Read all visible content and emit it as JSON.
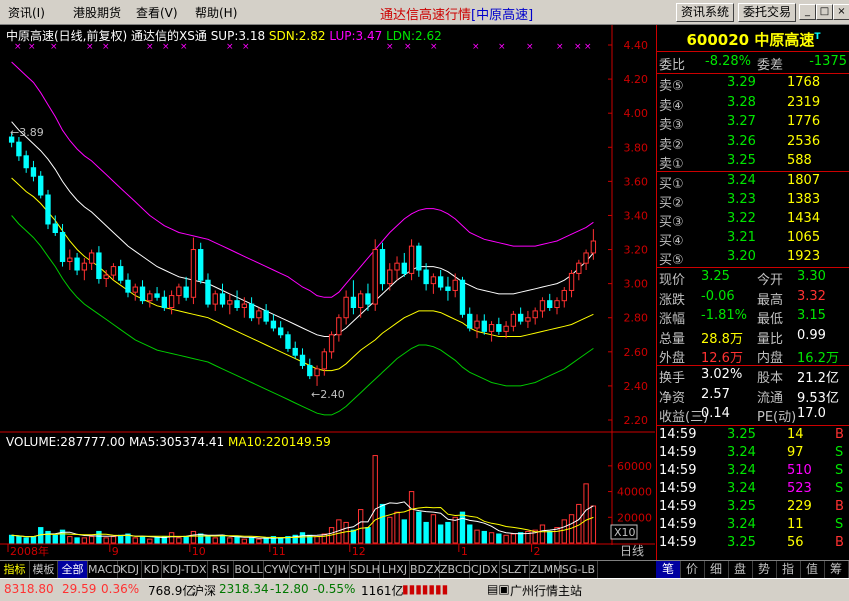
{
  "menu": {
    "items": [
      "资讯(I)",
      "港股期货",
      "查看(V)",
      "帮助(H)"
    ]
  },
  "app": {
    "title": "通达信高速行情",
    "subtitle": "[中原高速]"
  },
  "sys_buttons": {
    "info": "资讯系统",
    "trade": "委托交易"
  },
  "chart": {
    "header": {
      "stock": "中原高速(日线,前复权)",
      "indicator": "通达信的XS通",
      "sup": "SUP:3.18",
      "sdn": "SDN:2.82",
      "lup": "LUP:3.47",
      "ldn": "LDN:2.62"
    },
    "price_axis": [
      "4.40",
      "4.20",
      "4.00",
      "3.80",
      "3.60",
      "3.40",
      "3.20",
      "3.00",
      "2.80",
      "2.60",
      "2.40",
      "2.20"
    ],
    "high_mark": "3.89",
    "low_mark": "2.40",
    "volume_header": {
      "volume": "VOLUME:287777.00",
      "ma5": "MA5:305374.41",
      "ma10": "MA10:220149.59"
    },
    "volume_axis": [
      "60000",
      "40000",
      "20000"
    ],
    "volume_unit": "X10",
    "date_axis": [
      "2008年",
      "9",
      "10",
      "11",
      "12",
      "1",
      "2"
    ],
    "period": "日线"
  },
  "chart_data": {
    "type": "candlestick",
    "price_range": [
      2.2,
      4.4
    ],
    "volume_range": [
      0,
      70000
    ],
    "grid": false,
    "candles": [
      [
        3.86,
        3.89,
        3.8,
        3.83
      ],
      [
        3.83,
        3.86,
        3.72,
        3.75
      ],
      [
        3.75,
        3.78,
        3.65,
        3.68
      ],
      [
        3.68,
        3.72,
        3.6,
        3.63
      ],
      [
        3.63,
        3.66,
        3.5,
        3.52
      ],
      [
        3.52,
        3.55,
        3.32,
        3.35
      ],
      [
        3.35,
        3.4,
        3.28,
        3.3
      ],
      [
        3.3,
        3.35,
        3.1,
        3.13
      ],
      [
        3.13,
        3.2,
        3.08,
        3.15
      ],
      [
        3.15,
        3.18,
        3.05,
        3.08
      ],
      [
        3.08,
        3.15,
        3.02,
        3.12
      ],
      [
        3.12,
        3.2,
        3.08,
        3.18
      ],
      [
        3.18,
        3.22,
        3.0,
        3.03
      ],
      [
        3.03,
        3.08,
        2.98,
        3.05
      ],
      [
        3.05,
        3.12,
        3.02,
        3.1
      ],
      [
        3.1,
        3.14,
        3.0,
        3.02
      ],
      [
        3.02,
        3.06,
        2.92,
        2.95
      ],
      [
        2.95,
        3.0,
        2.9,
        2.98
      ],
      [
        2.98,
        3.02,
        2.88,
        2.9
      ],
      [
        2.9,
        2.96,
        2.86,
        2.94
      ],
      [
        2.94,
        2.98,
        2.9,
        2.92
      ],
      [
        2.92,
        2.96,
        2.84,
        2.86
      ],
      [
        2.86,
        2.96,
        2.82,
        2.93
      ],
      [
        2.93,
        3.0,
        2.88,
        2.98
      ],
      [
        2.98,
        3.04,
        2.9,
        2.92
      ],
      [
        2.92,
        3.27,
        2.88,
        3.2
      ],
      [
        3.2,
        3.24,
        3.0,
        3.02
      ],
      [
        3.02,
        3.06,
        2.86,
        2.88
      ],
      [
        2.88,
        2.96,
        2.84,
        2.94
      ],
      [
        2.94,
        3.0,
        2.86,
        2.88
      ],
      [
        2.88,
        2.94,
        2.82,
        2.9
      ],
      [
        2.9,
        2.96,
        2.84,
        2.86
      ],
      [
        2.86,
        2.92,
        2.8,
        2.88
      ],
      [
        2.88,
        2.92,
        2.78,
        2.8
      ],
      [
        2.8,
        2.86,
        2.76,
        2.84
      ],
      [
        2.84,
        2.88,
        2.76,
        2.78
      ],
      [
        2.78,
        2.82,
        2.72,
        2.74
      ],
      [
        2.74,
        2.78,
        2.68,
        2.7
      ],
      [
        2.7,
        2.72,
        2.6,
        2.62
      ],
      [
        2.62,
        2.66,
        2.56,
        2.58
      ],
      [
        2.58,
        2.62,
        2.5,
        2.52
      ],
      [
        2.52,
        2.56,
        2.44,
        2.46
      ],
      [
        2.46,
        2.52,
        2.4,
        2.5
      ],
      [
        2.5,
        2.62,
        2.46,
        2.6
      ],
      [
        2.6,
        2.72,
        2.56,
        2.7
      ],
      [
        2.7,
        2.82,
        2.66,
        2.8
      ],
      [
        2.8,
        2.96,
        2.76,
        2.92
      ],
      [
        2.92,
        3.02,
        2.82,
        2.86
      ],
      [
        2.86,
        2.96,
        2.8,
        2.94
      ],
      [
        2.94,
        3.0,
        2.84,
        2.88
      ],
      [
        2.88,
        3.26,
        2.84,
        3.2
      ],
      [
        3.2,
        3.24,
        2.96,
        3.0
      ],
      [
        3.0,
        3.12,
        2.96,
        3.08
      ],
      [
        3.08,
        3.16,
        3.02,
        3.12
      ],
      [
        3.12,
        3.18,
        3.04,
        3.06
      ],
      [
        3.06,
        3.26,
        3.02,
        3.22
      ],
      [
        3.22,
        3.24,
        3.04,
        3.08
      ],
      [
        3.08,
        3.12,
        2.96,
        3.0
      ],
      [
        3.0,
        3.06,
        2.94,
        3.04
      ],
      [
        3.04,
        3.08,
        2.96,
        2.98
      ],
      [
        2.98,
        3.04,
        2.9,
        2.96
      ],
      [
        2.96,
        3.06,
        2.92,
        3.02
      ],
      [
        3.02,
        3.04,
        2.8,
        2.82
      ],
      [
        2.82,
        2.86,
        2.72,
        2.74
      ],
      [
        2.74,
        2.82,
        2.68,
        2.78
      ],
      [
        2.78,
        2.82,
        2.7,
        2.72
      ],
      [
        2.72,
        2.78,
        2.66,
        2.76
      ],
      [
        2.76,
        2.8,
        2.7,
        2.72
      ],
      [
        2.72,
        2.78,
        2.68,
        2.75
      ],
      [
        2.75,
        2.84,
        2.72,
        2.82
      ],
      [
        2.82,
        2.86,
        2.76,
        2.78
      ],
      [
        2.78,
        2.84,
        2.74,
        2.8
      ],
      [
        2.8,
        2.86,
        2.76,
        2.84
      ],
      [
        2.84,
        2.92,
        2.8,
        2.9
      ],
      [
        2.9,
        2.94,
        2.84,
        2.86
      ],
      [
        2.86,
        2.92,
        2.82,
        2.9
      ],
      [
        2.9,
        2.98,
        2.86,
        2.96
      ],
      [
        2.96,
        3.08,
        2.92,
        3.06
      ],
      [
        3.06,
        3.14,
        3.02,
        3.12
      ],
      [
        3.12,
        3.2,
        3.08,
        3.18
      ],
      [
        3.18,
        3.32,
        3.14,
        3.25
      ]
    ],
    "volumes": [
      6000,
      5000,
      4000,
      5000,
      12000,
      9000,
      6000,
      10000,
      5000,
      4000,
      4000,
      5000,
      9000,
      4000,
      5000,
      6000,
      7000,
      4000,
      5000,
      3000,
      4000,
      5000,
      8000,
      4000,
      5000,
      9000,
      7000,
      5000,
      4000,
      6000,
      4000,
      5000,
      3000,
      4000,
      3000,
      4000,
      5000,
      4000,
      5000,
      6000,
      8000,
      6000,
      5000,
      7000,
      12000,
      18000,
      16000,
      10000,
      26000,
      12000,
      68000,
      30000,
      20000,
      24000,
      18000,
      40000,
      24000,
      16000,
      22000,
      14000,
      16000,
      20000,
      24000,
      14000,
      10000,
      9000,
      8000,
      7000,
      6000,
      7000,
      8000,
      9000,
      10000,
      14000,
      9000,
      12000,
      18000,
      22000,
      30000,
      46000,
      28778
    ],
    "lup": [
      4.3,
      4.26,
      4.22,
      4.18,
      4.12,
      4.05,
      3.98,
      3.9,
      3.84,
      3.79,
      3.75,
      3.72,
      3.68,
      3.64,
      3.6,
      3.56,
      3.52,
      3.48,
      3.44,
      3.4,
      3.37,
      3.34,
      3.32,
      3.3,
      3.29,
      3.28,
      3.27,
      3.26,
      3.24,
      3.22,
      3.2,
      3.18,
      3.16,
      3.14,
      3.12,
      3.1,
      3.08,
      3.06,
      3.04,
      3.01,
      2.98,
      2.96,
      2.93,
      2.92,
      2.92,
      2.95,
      3.0,
      3.05,
      3.1,
      3.15,
      3.2,
      3.25,
      3.3,
      3.34,
      3.38,
      3.41,
      3.43,
      3.44,
      3.44,
      3.43,
      3.41,
      3.38,
      3.34,
      3.3,
      3.28,
      3.26,
      3.25,
      3.24,
      3.23,
      3.22,
      3.22,
      3.22,
      3.22,
      3.23,
      3.24,
      3.25,
      3.27,
      3.29,
      3.31,
      3.33,
      3.36
    ],
    "sup": [
      3.95,
      3.9,
      3.86,
      3.82,
      3.78,
      3.73,
      3.67,
      3.6,
      3.54,
      3.49,
      3.45,
      3.42,
      3.38,
      3.34,
      3.3,
      3.26,
      3.22,
      3.19,
      3.16,
      3.13,
      3.1,
      3.08,
      3.06,
      3.04,
      3.03,
      3.02,
      3.01,
      3.0,
      2.98,
      2.96,
      2.94,
      2.92,
      2.9,
      2.88,
      2.86,
      2.84,
      2.82,
      2.8,
      2.78,
      2.76,
      2.74,
      2.72,
      2.7,
      2.69,
      2.69,
      2.71,
      2.74,
      2.78,
      2.82,
      2.86,
      2.9,
      2.94,
      2.98,
      3.02,
      3.05,
      3.08,
      3.1,
      3.1,
      3.1,
      3.09,
      3.07,
      3.04,
      3.01,
      2.99,
      2.97,
      2.96,
      2.95,
      2.94,
      2.94,
      2.94,
      2.95,
      2.96,
      2.97,
      2.98,
      2.99,
      3.0,
      3.02,
      3.05,
      3.09,
      3.13,
      3.18
    ],
    "sdn": [
      3.62,
      3.58,
      3.54,
      3.51,
      3.47,
      3.42,
      3.37,
      3.31,
      3.25,
      3.2,
      3.16,
      3.13,
      3.1,
      3.06,
      3.02,
      2.99,
      2.96,
      2.93,
      2.91,
      2.89,
      2.87,
      2.86,
      2.85,
      2.84,
      2.83,
      2.82,
      2.81,
      2.8,
      2.78,
      2.76,
      2.74,
      2.72,
      2.7,
      2.68,
      2.66,
      2.64,
      2.62,
      2.6,
      2.58,
      2.56,
      2.54,
      2.52,
      2.5,
      2.49,
      2.49,
      2.5,
      2.53,
      2.57,
      2.61,
      2.64,
      2.67,
      2.71,
      2.74,
      2.77,
      2.8,
      2.82,
      2.84,
      2.84,
      2.84,
      2.83,
      2.81,
      2.79,
      2.77,
      2.74,
      2.72,
      2.71,
      2.7,
      2.69,
      2.69,
      2.69,
      2.69,
      2.7,
      2.71,
      2.72,
      2.73,
      2.74,
      2.75,
      2.76,
      2.78,
      2.8,
      2.82
    ],
    "ldn": [
      3.4,
      3.35,
      3.31,
      3.27,
      3.22,
      3.16,
      3.1,
      3.03,
      2.97,
      2.92,
      2.88,
      2.85,
      2.82,
      2.79,
      2.76,
      2.73,
      2.7,
      2.67,
      2.65,
      2.63,
      2.61,
      2.6,
      2.59,
      2.58,
      2.57,
      2.56,
      2.55,
      2.54,
      2.52,
      2.5,
      2.48,
      2.46,
      2.44,
      2.42,
      2.4,
      2.38,
      2.36,
      2.34,
      2.32,
      2.3,
      2.28,
      2.26,
      2.24,
      2.23,
      2.23,
      2.25,
      2.28,
      2.32,
      2.36,
      2.4,
      2.44,
      2.48,
      2.52,
      2.56,
      2.59,
      2.62,
      2.64,
      2.64,
      2.63,
      2.61,
      2.58,
      2.55,
      2.51,
      2.48,
      2.46,
      2.44,
      2.42,
      2.41,
      2.4,
      2.4,
      2.4,
      2.41,
      2.42,
      2.44,
      2.46,
      2.48,
      2.5,
      2.53,
      2.56,
      2.59,
      2.62
    ]
  },
  "quote": {
    "code": "600020",
    "name": "中原高速",
    "mark": "T",
    "webi_label": "委比",
    "webi": "-8.28%",
    "wecha_label": "委差",
    "wecha": "-1375",
    "sells": [
      {
        "label": "卖⑤",
        "price": "3.29",
        "vol": "1768"
      },
      {
        "label": "卖④",
        "price": "3.28",
        "vol": "2319"
      },
      {
        "label": "卖③",
        "price": "3.27",
        "vol": "1776"
      },
      {
        "label": "卖②",
        "price": "3.26",
        "vol": "2536"
      },
      {
        "label": "卖①",
        "price": "3.25",
        "vol": "588"
      }
    ],
    "buys": [
      {
        "label": "买①",
        "price": "3.24",
        "vol": "1807"
      },
      {
        "label": "买②",
        "price": "3.23",
        "vol": "1383"
      },
      {
        "label": "买③",
        "price": "3.22",
        "vol": "1434"
      },
      {
        "label": "买④",
        "price": "3.21",
        "vol": "1065"
      },
      {
        "label": "买⑤",
        "price": "3.20",
        "vol": "1923"
      }
    ],
    "stats1": [
      {
        "l1": "现价",
        "v1": "3.25",
        "c1": "green",
        "l2": "今开",
        "v2": "3.30",
        "c2": "green"
      },
      {
        "l1": "涨跌",
        "v1": "-0.06",
        "c1": "green",
        "l2": "最高",
        "v2": "3.32",
        "c2": "red"
      },
      {
        "l1": "涨幅",
        "v1": "-1.81%",
        "c1": "green",
        "l2": "最低",
        "v2": "3.15",
        "c2": "green"
      },
      {
        "l1": "总量",
        "v1": "28.8万",
        "c1": "yellow",
        "l2": "量比",
        "v2": "0.99",
        "c2": "white"
      },
      {
        "l1": "外盘",
        "v1": "12.6万",
        "c1": "red",
        "l2": "内盘",
        "v2": "16.2万",
        "c2": "green"
      }
    ],
    "stats2": [
      {
        "l1": "换手",
        "v1": "3.02%",
        "l2": "股本",
        "v2": "21.2亿"
      },
      {
        "l1": "净资",
        "v1": "2.57",
        "l2": "流通",
        "v2": "9.53亿"
      },
      {
        "l1": "收益(三)",
        "v1": "0.14",
        "l2": "PE(动)",
        "v2": "17.0"
      }
    ],
    "ticks": [
      {
        "time": "14:59",
        "price": "3.25",
        "vol": "14",
        "side": "B",
        "pc": "green",
        "vc": "yellow",
        "sc": "red"
      },
      {
        "time": "14:59",
        "price": "3.24",
        "vol": "97",
        "side": "S",
        "pc": "green",
        "vc": "yellow",
        "sc": "green"
      },
      {
        "time": "14:59",
        "price": "3.24",
        "vol": "510",
        "side": "S",
        "pc": "green",
        "vc": "magenta",
        "sc": "green"
      },
      {
        "time": "14:59",
        "price": "3.24",
        "vol": "523",
        "side": "S",
        "pc": "green",
        "vc": "magenta",
        "sc": "green"
      },
      {
        "time": "14:59",
        "price": "3.25",
        "vol": "229",
        "side": "B",
        "pc": "green",
        "vc": "yellow",
        "sc": "red"
      },
      {
        "time": "14:59",
        "price": "3.24",
        "vol": "11",
        "side": "S",
        "pc": "green",
        "vc": "yellow",
        "sc": "green"
      },
      {
        "time": "14:59",
        "price": "3.25",
        "vol": "56",
        "side": "B",
        "pc": "green",
        "vc": "yellow",
        "sc": "red"
      }
    ]
  },
  "bottom_tabs": [
    "指标",
    "模板",
    "全部",
    "MACD",
    "KDJ",
    "KD",
    "KDJ-TDX",
    "RSI",
    "BOLL",
    "CYW",
    "CYHT",
    "LYJH",
    "SDLH",
    "LHXJ",
    "BDZX",
    "ZBCD",
    "CJDX",
    "SLZT",
    "ZLMM",
    "SG-LB"
  ],
  "right_tabs": [
    "笔",
    "价",
    "细",
    "盘",
    "势",
    "指",
    "值",
    "筹"
  ],
  "status": {
    "sh_index": "8318.80",
    "sh_chg": "29.59",
    "sh_pct": "0.36%",
    "sh_amt": "768.9亿",
    "sz_label": "沪深",
    "sz_index": "2318.34",
    "sz_chg": "-12.80",
    "sz_pct": "-0.55%",
    "sz_amt": "1161亿",
    "server": "广州行情主站"
  },
  "colors": {
    "up": "#ff3232",
    "down": "#00ffff",
    "lup": "#ff00ff",
    "sup": "#ffffff",
    "sdn": "#ffff00",
    "ldn": "#00cc00",
    "ma5": "#ffffff",
    "ma10": "#ffff00",
    "border": "#cc0000"
  }
}
